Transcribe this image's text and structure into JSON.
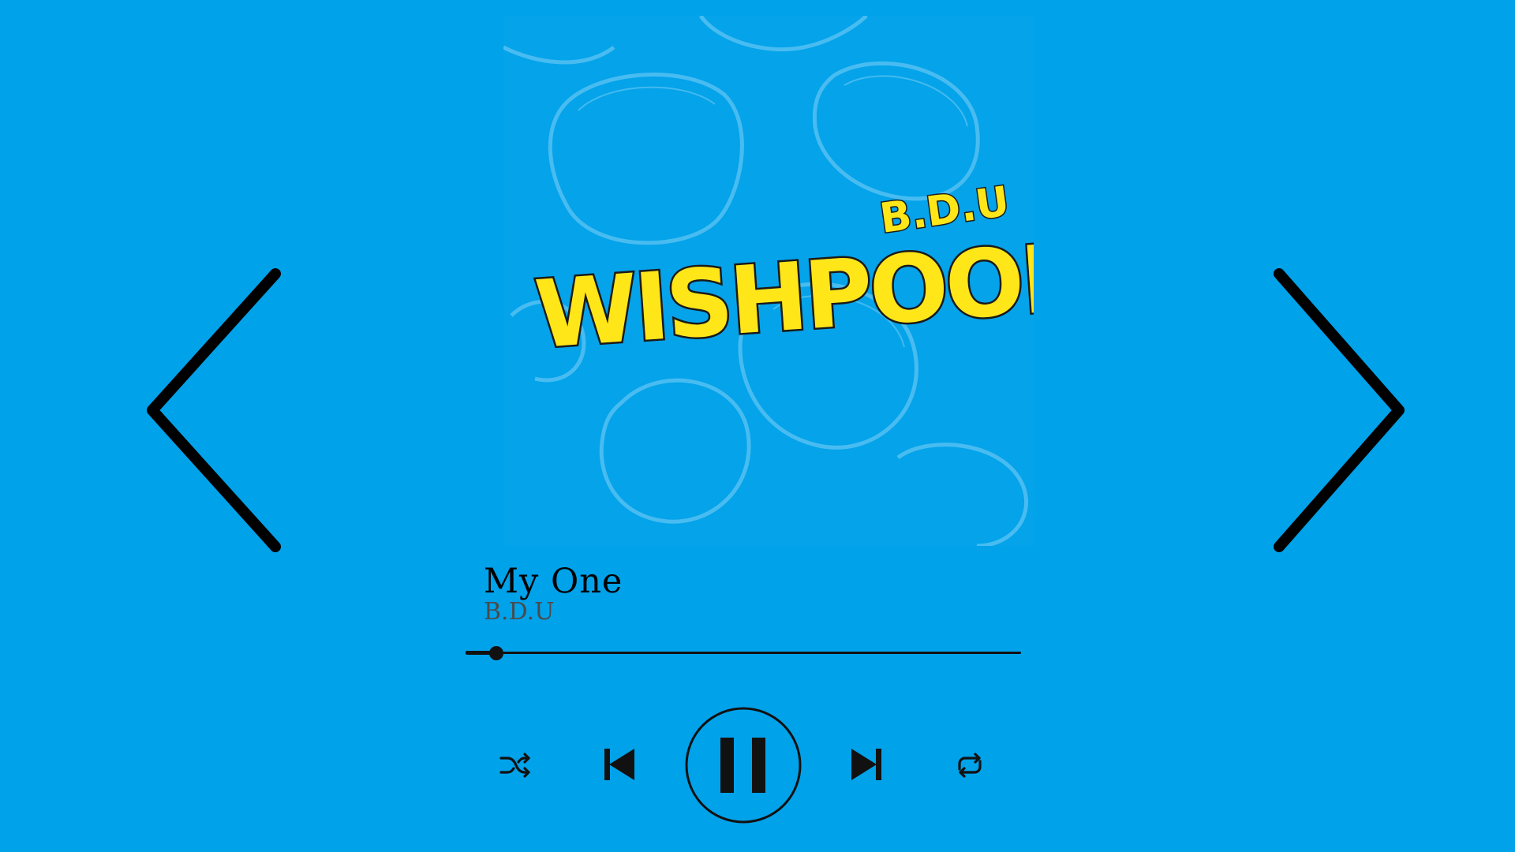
{
  "player": {
    "album": {
      "logo_text": "WISHPOOL",
      "logo_artist": "B.D.U",
      "background_color": "#04a3ea",
      "logo_color": "#ffe619"
    },
    "track": {
      "title": "My One",
      "artist": "B.D.U"
    },
    "progress_fraction": 0.055,
    "controls": {
      "shuffle_icon": "shuffle-icon",
      "previous_icon": "skip-previous-icon",
      "play_state_icon": "pause-icon",
      "next_icon": "skip-next-icon",
      "repeat_icon": "repeat-icon"
    },
    "navigation": {
      "prev_icon": "chevron-left-icon",
      "next_icon": "chevron-right-icon"
    },
    "colors": {
      "background": "#00a2ea",
      "foreground": "#111111",
      "artist_text": "#4a4a4a"
    }
  }
}
